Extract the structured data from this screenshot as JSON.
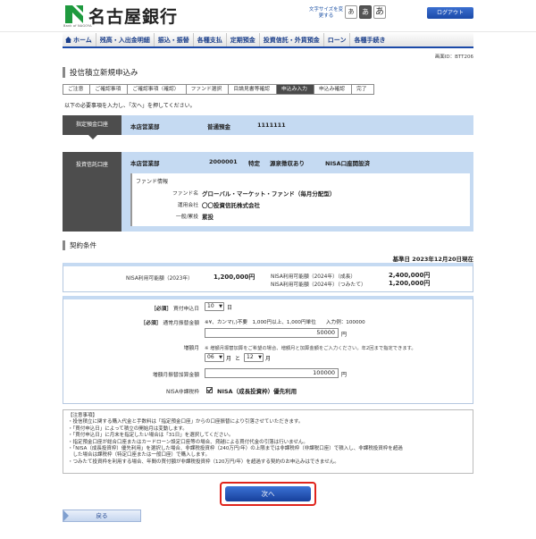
{
  "header": {
    "logo_sub": "Bank of NAGOYA",
    "bank_name": "名古屋銀行",
    "font_size_label": "文字サイズを変更する",
    "font_sizes": [
      "あ",
      "あ",
      "あ"
    ],
    "logout": "ログアウト"
  },
  "nav": [
    "ホーム",
    "残高・入出金明細",
    "振込・振替",
    "各種支払",
    "定期預金",
    "投資信託・外貨預金",
    "ローン",
    "各種手続き"
  ],
  "screen_id": "画面ID：BTT206",
  "page_title": "投信積立新規申込み",
  "steps": [
    "ご注意",
    "ご確認事項",
    "ご確認事項（確認）",
    "ファンド選択",
    "目論見書等確認",
    "申込み入力",
    "申込み確認",
    "完了"
  ],
  "active_step_index": 5,
  "instruction": "以下の必要事項を入力し、「次へ」を押してください。",
  "debit_account": {
    "label": "指定預金口座",
    "branch": "本店営業部",
    "type": "普通預金",
    "number": "1111111"
  },
  "trust_account": {
    "label": "投資信託口座",
    "branch": "本店営業部",
    "number": "2000001",
    "kind": "特定",
    "tax": "源泉徴収あり",
    "nisa": "NISA口座開設済",
    "fund_info_header": "ファンド情報",
    "fund_name_label": "ファンド名",
    "fund_name": "グローバル・マーケット・ファンド（毎月分配型）",
    "company_label": "運用会社",
    "company": "〇〇投資信託株式会社",
    "category_label": "一般/累投",
    "category": "累投"
  },
  "contract": {
    "section_title": "契約条件",
    "base_date": "基準日 2023年12月20日現在",
    "nisa_2023_label": "NISA利用可能額（2023年）",
    "nisa_2023_value": "1,200,000円",
    "nisa_2024_growth_label": "NISA利用可能額（2024年）（成長）",
    "nisa_2024_growth_value": "2,400,000円",
    "nisa_2024_tsumitate_label": "NISA利用可能額（2024年）（つみたて）",
    "nisa_2024_tsumitate_value": "1,200,000円"
  },
  "form": {
    "required": "［必須］",
    "day_label": "買付申込日",
    "day_value": "10",
    "day_unit": "日",
    "amount_label": "通常月振替金額",
    "amount_hint": "※¥、カンマ(,)不要　1,000円以上、1,000円単位　　入力例：100000",
    "amount_value": "50000",
    "yen": "円",
    "bonus_label": "増額月",
    "bonus_hint": "※ 増額月振替加算をご希望の場合、増額月と加算金額をご入力ください。年2回まで指定できます。",
    "month1": "06",
    "month2": "12",
    "month_unit": "月",
    "and": "と",
    "bonus_amount_label": "増額月振替加算金額",
    "bonus_amount_value": "100000",
    "nisa_label": "NISA非課税枠",
    "nisa_option": "NISA（成長投資枠）優先利用"
  },
  "notes": [
    "【注意事項】",
    "・投信積立に関する購入代金と手数料は「指定預金口座」からの口座振替により引落させていただきます。",
    "・「買付申込日」によって積立の開始月は変動します。",
    "・「買付申込日」に月末を指定したい場合は「31日」を選択してください。",
    "・指定預金口座が総合口座またはカードローン設定口座等の場合、貸越による買付代金の引落は行いません。",
    "・「NISA（成長投資枠）優先利用」を選択した場合、非課税投資枠（240万円/年）の上限までは非課税枠（非課税口座）で積入し、非課税投資枠を超過",
    "　した場合は課税枠（特定口座または一般口座）で購入します。",
    "・つみたて投資枠を利用する場合、年間の買付額が非課税投資枠（120万円/年）を超過する契約のお申込みはできません。"
  ],
  "buttons": {
    "next": "次へ",
    "back": "戻る"
  },
  "colors": {
    "brand_blue": "#1b4aa8",
    "panel_blue": "#c5daf2",
    "highlight_red": "#e0241c",
    "logo_green": "#1f9a3f"
  }
}
